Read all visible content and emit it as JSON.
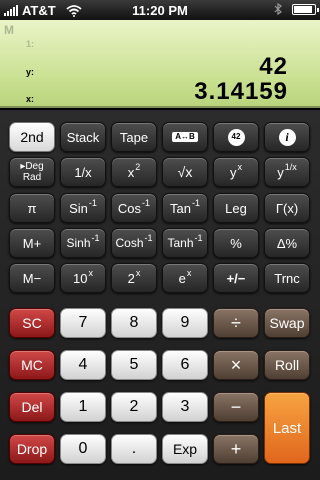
{
  "status_bar": {
    "carrier": "AT&T",
    "time": "11:20 PM",
    "icons": [
      "signal-bars-icon",
      "wifi-icon",
      "bluetooth-icon",
      "battery-icon"
    ],
    "battery_level": 0.9
  },
  "display": {
    "mode_indicator": "M",
    "registers": [
      {
        "label": "1:",
        "value": ""
      },
      {
        "label": "y:",
        "value": "42"
      },
      {
        "label": "x:",
        "value": "3.14159"
      }
    ]
  },
  "keys": {
    "row1": {
      "second": "2nd",
      "stack": "Stack",
      "tape": "Tape",
      "swap_ab": "A↔B",
      "about": "42",
      "info": "i"
    },
    "row2": {
      "deg_rad_top": "▸Deg",
      "deg_rad_bottom": "Rad",
      "reciprocal": "1/x",
      "square_base": "x",
      "square_exp": "2",
      "sqrt": "√x",
      "power_base": "y",
      "power_exp": "x",
      "root_base": "y",
      "root_exp": "1/x"
    },
    "row3": {
      "pi": "π",
      "asin_base": "Sin",
      "asin_exp": "-1",
      "acos_base": "Cos",
      "acos_exp": "-1",
      "atan_base": "Tan",
      "atan_exp": "-1",
      "log": "Leg",
      "gamma": "Γ(x)"
    },
    "row4": {
      "mem_plus": "M+",
      "asinh_base": "Sinh",
      "asinh_exp": "-1",
      "acosh_base": "Cosh",
      "acosh_exp": "-1",
      "atanh_base": "Tanh",
      "atanh_exp": "-1",
      "percent": "%",
      "delta_percent": "Δ%"
    },
    "row5": {
      "mem_minus": "M−",
      "pow10_base": "10",
      "pow10_exp": "x",
      "pow2_base": "2",
      "pow2_exp": "x",
      "exp_base": "e",
      "exp_exp": "x",
      "plus_minus": "+/−",
      "trunc": "Trnc"
    },
    "row6": {
      "sc": "SC",
      "d7": "7",
      "d8": "8",
      "d9": "9",
      "divide": "÷",
      "swap": "Swap"
    },
    "row7": {
      "mc": "MC",
      "d4": "4",
      "d5": "5",
      "d6": "6",
      "multiply": "×",
      "roll": "Roll"
    },
    "row8": {
      "del": "Del",
      "d1": "1",
      "d2": "2",
      "d3": "3",
      "minus": "−",
      "last": "Last"
    },
    "row9": {
      "drop": "Drop",
      "d0": "0",
      "dot": ".",
      "exp_key": "Exp",
      "plus": "+"
    }
  }
}
